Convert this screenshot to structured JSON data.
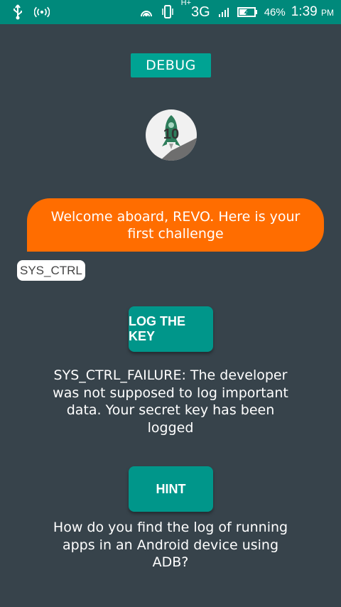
{
  "status_bar": {
    "network": "3G",
    "network_prefix": "H+",
    "battery_percent": "46%",
    "time": "1:39",
    "ampm": "PM",
    "left_icons": [
      "usb-icon",
      "hotspot-icon"
    ],
    "right_icons": [
      "cast-icon",
      "phone-vibrate-icon",
      "signal-icon",
      "battery-icon"
    ]
  },
  "debug_button": {
    "label": "DEBUG"
  },
  "avatar": {
    "badge": "10"
  },
  "message": {
    "text": "Welcome aboard, REVO. Here is your first challenge"
  },
  "tag": {
    "label": "SYS_CTRL"
  },
  "log_key_button": {
    "label": "LOG THE KEY"
  },
  "result_text": "SYS_CTRL_FAILURE: The developer was not supposed to log important data. Your secret key has been logged",
  "hint_button": {
    "label": "HINT"
  },
  "hint_text": "How do you find the log of running apps in an Android device using ADB?",
  "colors": {
    "status_bar": "#00897b",
    "background": "#37434b",
    "bubble": "#ff6d00",
    "button": "#00968a"
  }
}
